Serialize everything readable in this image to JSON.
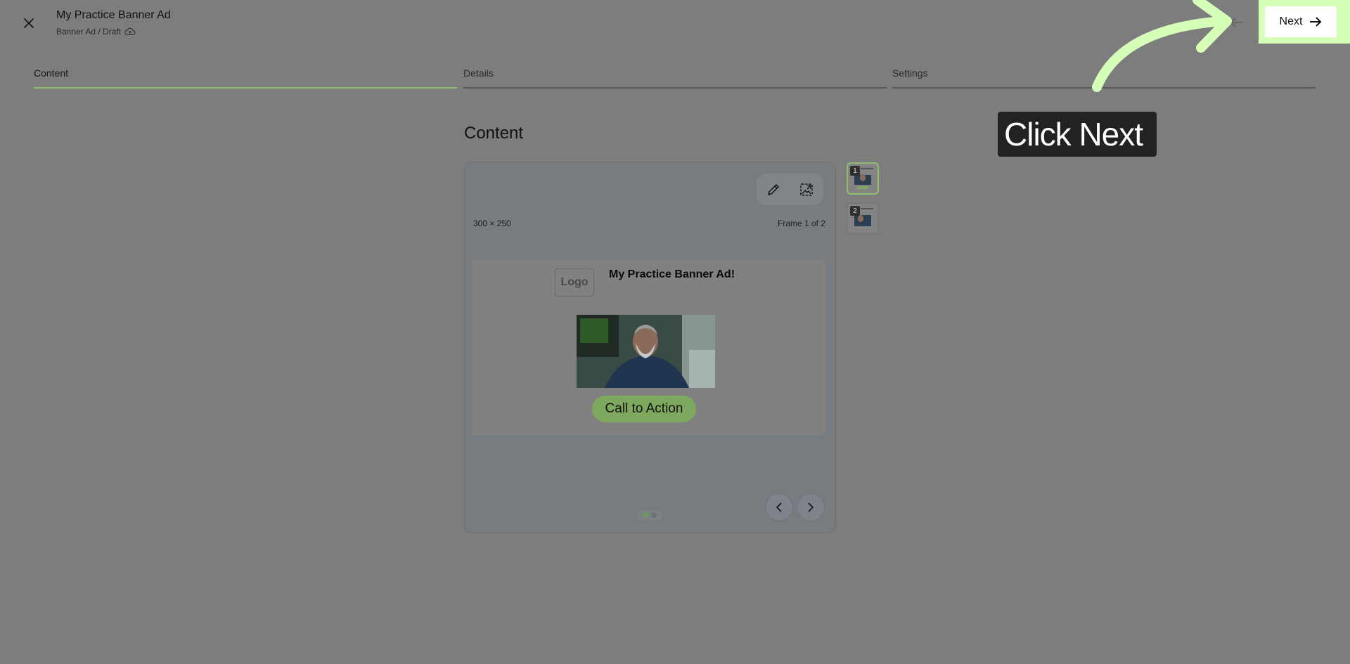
{
  "header": {
    "title": "My Practice Banner Ad",
    "subtitle": "Banner Ad / Draft",
    "next_label": "Next"
  },
  "tabs": [
    {
      "label": "Content",
      "active": true
    },
    {
      "label": "Details",
      "active": false
    },
    {
      "label": "Settings",
      "active": false
    }
  ],
  "content": {
    "section_title": "Content",
    "size_label": "300 × 250",
    "frame_label": "Frame 1 of 2",
    "banner": {
      "logo_text": "Logo",
      "title": "My Practice Banner Ad!",
      "cta_label": "Call to Action"
    },
    "thumbnails": [
      {
        "number": "1",
        "active": true
      },
      {
        "number": "2",
        "active": false
      }
    ]
  },
  "callout": {
    "text": "Click Next"
  },
  "colors": {
    "accent": "#8fbf6a",
    "highlight": "#d6ffb8",
    "overlay": "#7d7d7d"
  }
}
